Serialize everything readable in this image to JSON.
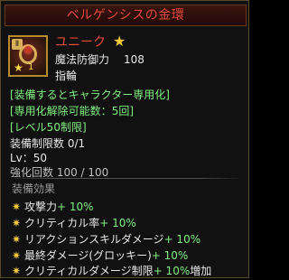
{
  "tooltip": {
    "title": "ベルゲンシスの金環",
    "rarity": "ユニーク",
    "rarity_star": "★",
    "stat_label": "魔法防御力",
    "stat_value": "108",
    "item_type": "指輪",
    "icon": {
      "name": "ring-icon",
      "level_badge": "Ⅱ",
      "star_badge": "★",
      "star_count": "1"
    },
    "details": {
      "bind_note": "[装備するとキャラクター専用化]",
      "unbind_prefix": "[専用化解除可能数：",
      "unbind_count": "5回",
      "unbind_suffix": "]",
      "level_limit": "[レベル50制限]",
      "equip_limit": "装備制限数 0/1",
      "lv": "Lv：50",
      "enhance": "強化回数 100 / 100"
    },
    "effects": {
      "header": "装備効果",
      "items": [
        {
          "icon": "✷",
          "label": "攻撃力",
          "value": "+ 10%",
          "suffix": ""
        },
        {
          "icon": "✷",
          "label": "クリティカル率",
          "value": "+ 10%",
          "suffix": ""
        },
        {
          "icon": "✷",
          "label": "リアクションスキルダメージ",
          "value": "+ 10%",
          "suffix": ""
        },
        {
          "icon": "✷",
          "label": "最終ダメージ(グロッキー)",
          "value": "+ 10%",
          "suffix": ""
        },
        {
          "icon": "✷",
          "label": "クリティカルダメージ制限",
          "value": "+ 10%",
          "suffix": "増加"
        }
      ]
    },
    "colors": {
      "title_red": "#e24a3a",
      "green": "#7ff07f",
      "gold": "#d8b25a"
    }
  }
}
